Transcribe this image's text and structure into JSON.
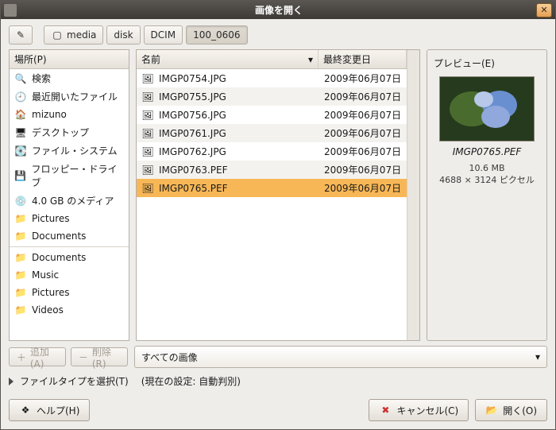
{
  "window": {
    "title": "画像を開く"
  },
  "pathbar": {
    "segments": [
      "media",
      "disk",
      "DCIM",
      "100_0606"
    ],
    "activeIndex": 3
  },
  "places": {
    "header": "場所(P)",
    "groups": [
      [
        {
          "icon": "search-icon",
          "label": "検索"
        },
        {
          "icon": "recent-icon",
          "label": "最近開いたファイル"
        },
        {
          "icon": "home-icon",
          "label": "mizuno"
        },
        {
          "icon": "desktop-icon",
          "label": "デスクトップ"
        },
        {
          "icon": "drive-icon",
          "label": "ファイル・システム"
        },
        {
          "icon": "floppy-icon",
          "label": "フロッピー・ドライブ"
        },
        {
          "icon": "cd-icon",
          "label": "4.0 GB のメディア"
        },
        {
          "icon": "folder-icon",
          "label": "Pictures"
        },
        {
          "icon": "folder-icon",
          "label": "Documents"
        }
      ],
      [
        {
          "icon": "folder-icon",
          "label": "Documents"
        },
        {
          "icon": "folder-icon",
          "label": "Music"
        },
        {
          "icon": "folder-icon",
          "label": "Pictures"
        },
        {
          "icon": "folder-icon",
          "label": "Videos"
        }
      ]
    ]
  },
  "fileHeaders": {
    "name": "名前",
    "modified": "最終変更日"
  },
  "files": [
    {
      "name": "IMGP0754.JPG",
      "date": "2009年06月07日",
      "selected": false
    },
    {
      "name": "IMGP0755.JPG",
      "date": "2009年06月07日",
      "selected": false
    },
    {
      "name": "IMGP0756.JPG",
      "date": "2009年06月07日",
      "selected": false
    },
    {
      "name": "IMGP0761.JPG",
      "date": "2009年06月07日",
      "selected": false
    },
    {
      "name": "IMGP0762.JPG",
      "date": "2009年06月07日",
      "selected": false
    },
    {
      "name": "IMGP0763.PEF",
      "date": "2009年06月07日",
      "selected": false
    },
    {
      "name": "IMGP0765.PEF",
      "date": "2009年06月07日",
      "selected": true
    }
  ],
  "preview": {
    "heading": "プレビュー(E)",
    "filename": "IMGP0765.PEF",
    "size": "10.6 MB",
    "dimensions": "4688 × 3124 ピクセル"
  },
  "buttons": {
    "add": "追加(A)",
    "remove": "削除(R)",
    "help": "ヘルプ(H)",
    "cancel": "キャンセル(C)",
    "open": "開く(O)"
  },
  "filter": {
    "value": "すべての画像"
  },
  "filetype": {
    "label": "ファイルタイプを選択(T)",
    "current_prefix": "(現在の設定: ",
    "current_value": "自動判別",
    "current_suffix": ")"
  }
}
